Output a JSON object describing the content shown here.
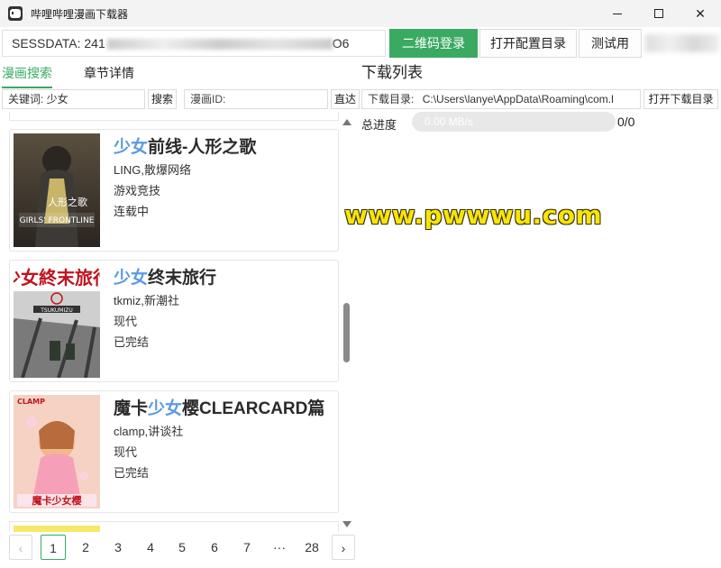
{
  "window": {
    "title": "哔哩哔哩漫画下载器"
  },
  "session": {
    "value": "SESSDATA: 241",
    "value_tail": "O6",
    "qr_login_label": "二维码登录",
    "open_config_label": "打开配置目录",
    "test_label": "测试用"
  },
  "tabs": [
    {
      "label": "漫画搜索",
      "active": true
    },
    {
      "label": "章节详情",
      "active": false
    }
  ],
  "search": {
    "keyword_value": "关键词: 少女",
    "search_label": "搜索",
    "id_placeholder": "漫画ID:",
    "direct_label": "直达"
  },
  "results": [
    {
      "title_pre": "",
      "title_hl": "少女",
      "title_post": "前线-人形之歌",
      "author": "LING,散爆网络",
      "genre": "游戏竞技",
      "status": "连载中"
    },
    {
      "title_pre": "",
      "title_hl": "少女",
      "title_post": "终末旅行",
      "author": "tkmiz,新潮社",
      "genre": "现代",
      "status": "已完结"
    },
    {
      "title_pre": "魔卡",
      "title_hl": "少女",
      "title_post": "樱CLEARCARD篇",
      "author": "clamp,讲谈社",
      "genre": "现代",
      "status": "已完结"
    }
  ],
  "pagination": {
    "prev": "‹",
    "pages": [
      "1",
      "2",
      "3",
      "4",
      "5",
      "6",
      "7",
      "···",
      "28"
    ],
    "current": "1",
    "next": "›"
  },
  "download": {
    "title": "下载列表",
    "dir_label": "下载目录:",
    "dir_value": "C:\\Users\\lanye\\AppData\\Roaming\\com.l",
    "open_dir_label": "打开下载目录",
    "progress_label": "总进度",
    "speed": "0.00 MB/s",
    "count": "0/0"
  },
  "watermark": "www.pwwwu.com",
  "colors": {
    "accent": "#3aaa63",
    "highlight": "#5c9ae0"
  }
}
